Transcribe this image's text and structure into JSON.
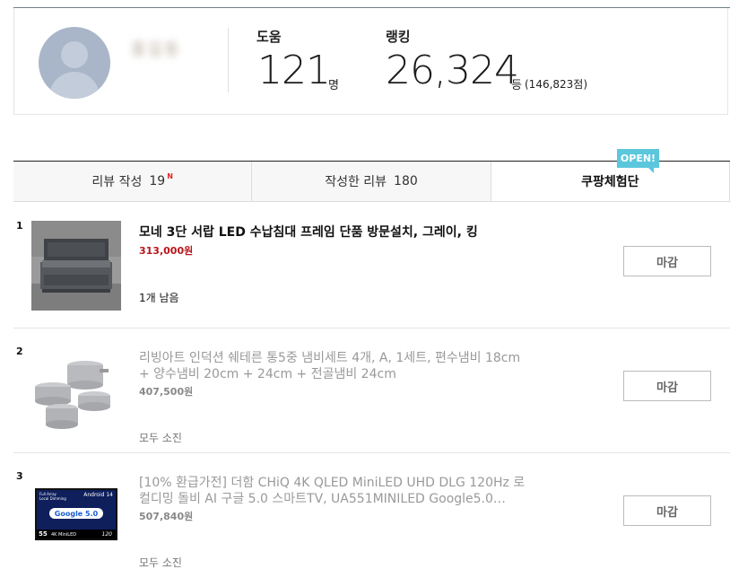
{
  "profile": {
    "username": "홍길동",
    "help_label": "도움",
    "help_value": "121",
    "help_unit": "명",
    "rank_label": "랭킹",
    "rank_value": "26,324",
    "rank_unit": "등",
    "rank_score": "(146,823점)"
  },
  "tabs": [
    {
      "label": "리뷰 작성",
      "count": "19",
      "new": "N"
    },
    {
      "label": "작성한 리뷰",
      "count": "180"
    },
    {
      "label": "쿠팡체험단"
    }
  ],
  "open_badge": "OPEN!",
  "items": [
    {
      "num": "1",
      "title": "모네 3단 서랍 LED 수납침대 프레임 단품 방문설치, 그레이, 킹",
      "price": "313,000원",
      "status": "1개 남음",
      "button": "마감"
    },
    {
      "num": "2",
      "title": "리빙아트 인덕션 쉐테른 통5중 냄비세트 4개, A, 1세트, 편수냄비 18cm + 양수냄비 20cm + 24cm + 전골냄비 24cm",
      "price": "407,500원",
      "status": "모두 소진",
      "button": "마감"
    },
    {
      "num": "3",
      "title": "[10% 환급가전] 더함 CHiQ 4K QLED MiniLED UHD DLG 120Hz 로컬디밍 돌비 AI 구글 5.0 스마트TV, UA551MINILED Google5.0…",
      "price": "507,840원",
      "status": "모두 소진",
      "button": "마감",
      "tv": {
        "top_left": "Full Array\nLocal Dimming",
        "top_right": "Android 14",
        "brand": "Google 5.0",
        "size": "55",
        "panel": "4K MiniLED",
        "hz": "120"
      }
    }
  ],
  "colors": {
    "accent_red": "#b8151c",
    "badge": "#5bc7dc",
    "rule": "#6e7f86"
  }
}
